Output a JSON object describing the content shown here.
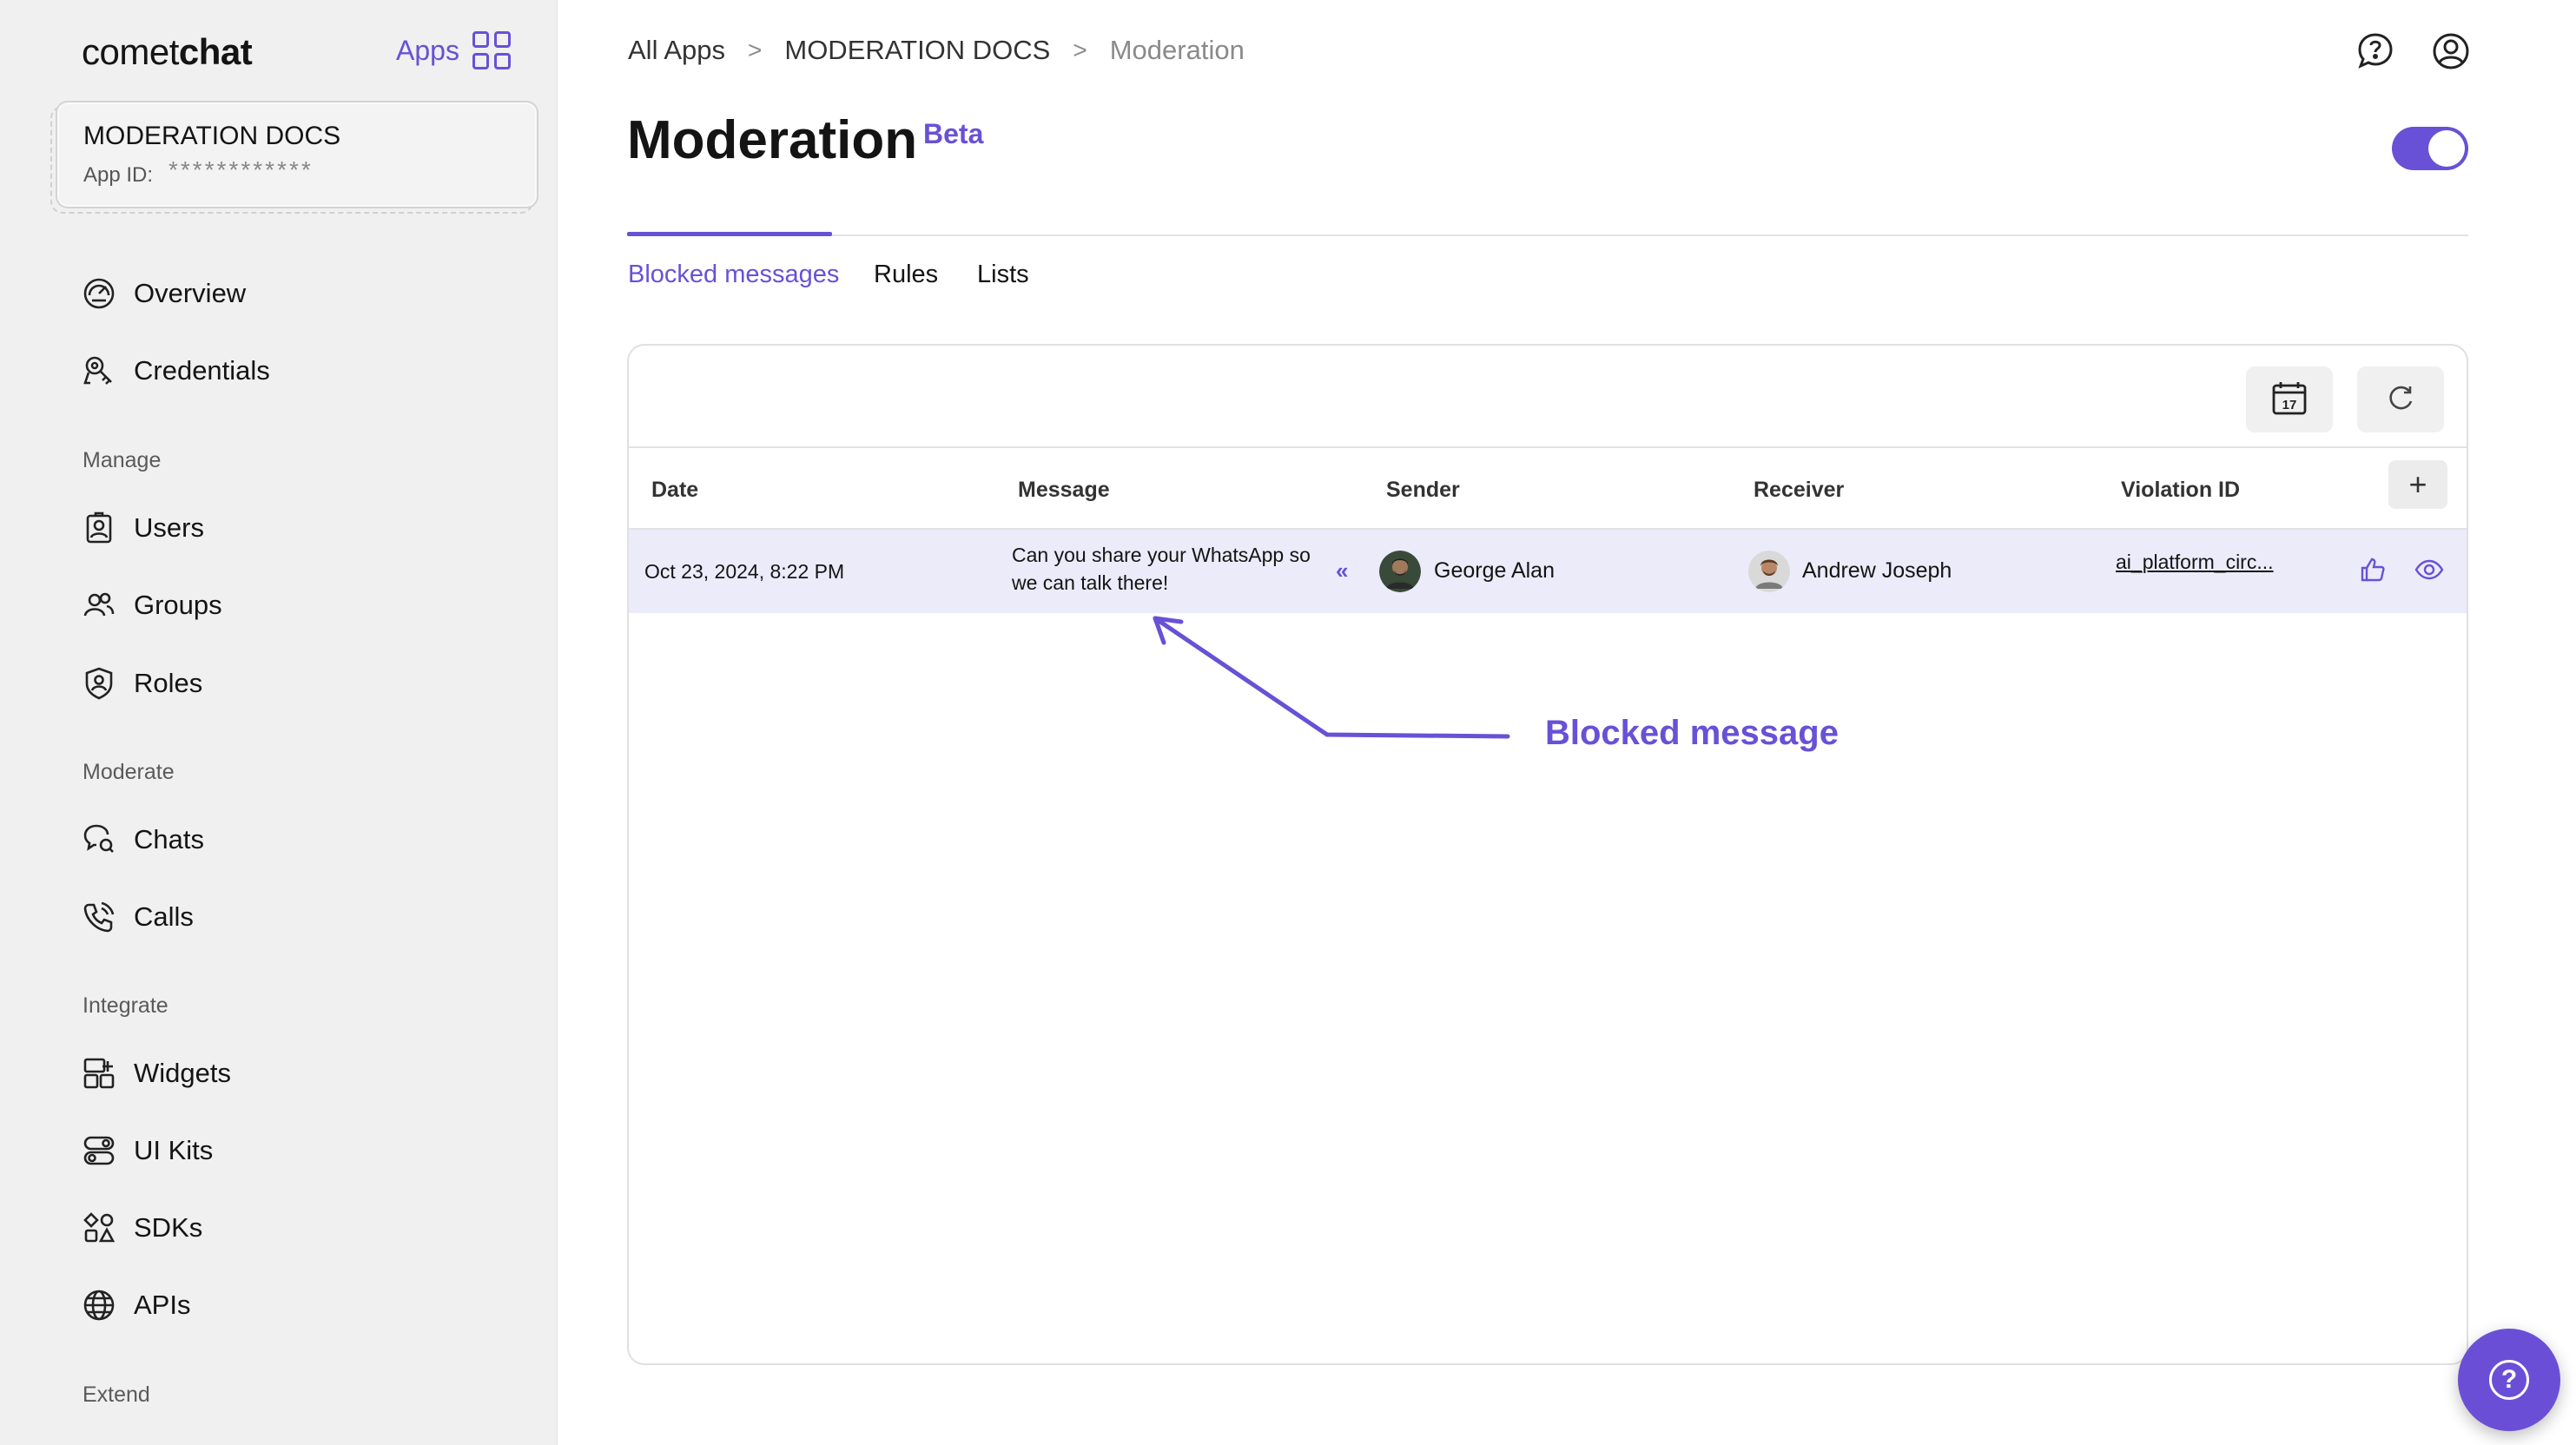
{
  "sidebar": {
    "logo_light": "comet",
    "logo_bold": "chat",
    "apps_label": "Apps",
    "app_name": "MODERATION DOCS",
    "app_id_label": "App ID:",
    "app_id_value": "************",
    "nav_top": [
      {
        "label": "Overview",
        "icon": "dashboard-gauge-icon"
      },
      {
        "label": "Credentials",
        "icon": "key-icon"
      }
    ],
    "sections": {
      "manage": "Manage",
      "moderate": "Moderate",
      "integrate": "Integrate",
      "extend": "Extend"
    },
    "manage_items": [
      {
        "label": "Users",
        "icon": "user-badge-icon"
      },
      {
        "label": "Groups",
        "icon": "users-icon"
      },
      {
        "label": "Roles",
        "icon": "shield-user-icon"
      }
    ],
    "moderate_items": [
      {
        "label": "Chats",
        "icon": "chat-search-icon"
      },
      {
        "label": "Calls",
        "icon": "phone-icon"
      }
    ],
    "integrate_items": [
      {
        "label": "Widgets",
        "icon": "widget-icon"
      },
      {
        "label": "UI Kits",
        "icon": "toggles-icon"
      },
      {
        "label": "SDKs",
        "icon": "blocks-icon"
      },
      {
        "label": "APIs",
        "icon": "globe-icon"
      }
    ]
  },
  "breadcrumb": {
    "items": [
      "All Apps",
      "MODERATION DOCS",
      "Moderation"
    ],
    "separator": ">"
  },
  "header": {
    "title": "Moderation",
    "badge": "Beta",
    "toggle_on": true
  },
  "tabs": [
    {
      "label": "Blocked messages",
      "active": true
    },
    {
      "label": "Rules",
      "active": false
    },
    {
      "label": "Lists",
      "active": false
    }
  ],
  "toolbar": {
    "calendar_day": "17",
    "calendar_icon": "calendar-icon",
    "refresh_icon": "refresh-icon"
  },
  "table": {
    "columns": [
      "Date",
      "Message",
      "Sender",
      "Receiver",
      "Violation ID"
    ],
    "add_column_label": "+",
    "rows": [
      {
        "date": "Oct 23, 2024, 8:22 PM",
        "message_line1": "Can you share your WhatsApp so",
        "message_line2": "we can talk there!",
        "expand": "«",
        "sender": "George Alan",
        "receiver": "Andrew Joseph",
        "violation_id": "ai_platform_circ..."
      }
    ]
  },
  "annotation": {
    "text": "Blocked message"
  },
  "colors": {
    "accent": "#6851d6",
    "row_highlight": "#ecebfa",
    "sidebar_bg": "#f0f0f0"
  },
  "help_label": "?"
}
